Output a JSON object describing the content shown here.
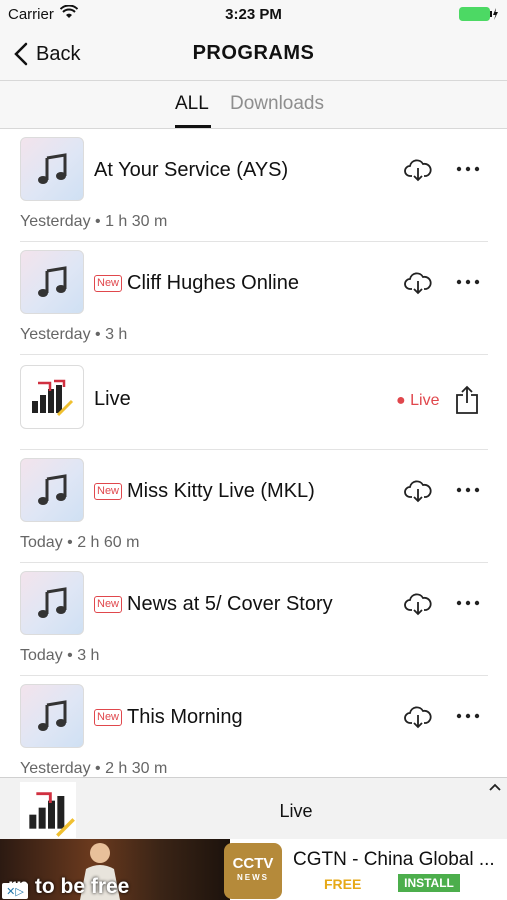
{
  "status_bar": {
    "carrier": "Carrier",
    "time": "3:23 PM"
  },
  "nav": {
    "back_label": "Back",
    "title": "PROGRAMS"
  },
  "tabs": [
    {
      "label": "ALL",
      "active": true
    },
    {
      "label": "Downloads",
      "active": false
    }
  ],
  "programs": [
    {
      "name": "At Your Service (AYS)",
      "is_new": false,
      "meta": "Yesterday • 1 h 30 m"
    },
    {
      "name": "Cliff Hughes Online",
      "is_new": true,
      "meta": "Yesterday • 3 h"
    },
    {
      "name": "Live",
      "is_live": true,
      "live_label": "Live"
    },
    {
      "name": "Miss Kitty Live (MKL)",
      "is_new": true,
      "meta": "Today • 2 h 60 m"
    },
    {
      "name": "News at 5/ Cover Story",
      "is_new": true,
      "meta": "Today • 3 h"
    },
    {
      "name": "This Morning",
      "is_new": true,
      "meta": "Yesterday • 2 h 30 m"
    }
  ],
  "new_badge": "New",
  "player": {
    "title": "Live"
  },
  "ad": {
    "tagline": "rn to be free",
    "logo_text": "CCTV",
    "logo_sub": "NEWS",
    "title": "CGTN - China Global ...",
    "price": "FREE",
    "install": "INSTALL"
  },
  "colors": {
    "accent_red": "#e0474c",
    "install_green": "#4cae4c",
    "free_orange": "#e6a817",
    "battery_green": "#4cd964"
  }
}
